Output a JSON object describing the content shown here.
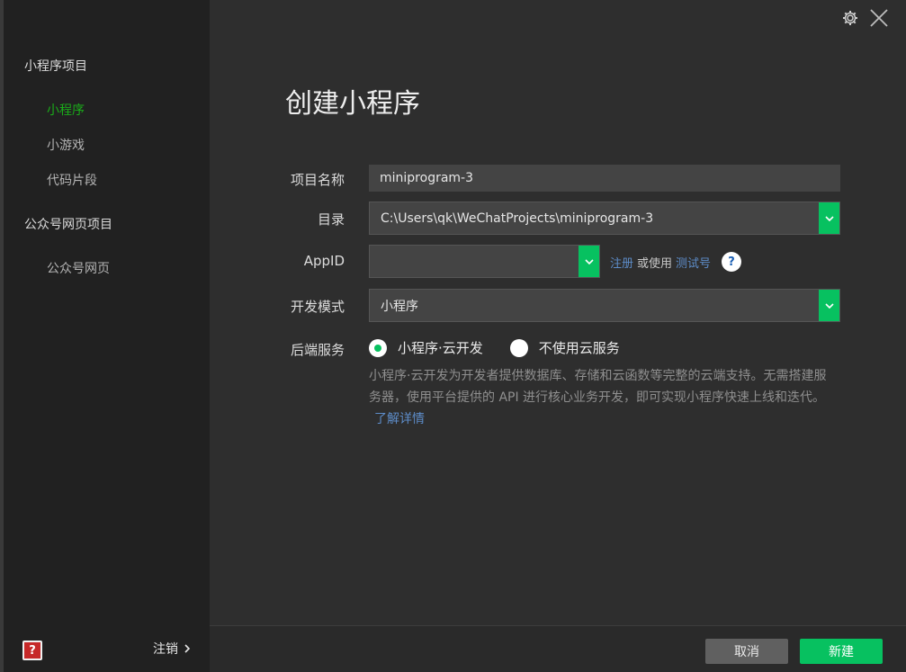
{
  "sidebar": {
    "groups": [
      {
        "label": "小程序项目",
        "items": [
          "小程序",
          "小游戏",
          "代码片段"
        ]
      },
      {
        "label": "公众号网页项目",
        "items": [
          "公众号网页"
        ]
      }
    ],
    "active_item": "小程序",
    "logout_label": "注销"
  },
  "main": {
    "title": "创建小程序",
    "form": {
      "project_name_label": "项目名称",
      "project_name_value": "miniprogram-3",
      "directory_label": "目录",
      "directory_value": "C:\\Users\\qk\\WeChatProjects\\miniprogram-3",
      "appid_label": "AppID",
      "appid_value": "",
      "appid_register_link": "注册",
      "appid_or_use": "或使用",
      "appid_test_link": "测试号",
      "dev_mode_label": "开发模式",
      "dev_mode_value": "小程序",
      "backend_label": "后端服务",
      "backend_options": [
        "小程序·云开发",
        "不使用云服务"
      ],
      "backend_selected": "小程序·云开发",
      "backend_desc": "小程序·云开发为开发者提供数据库、存储和云函数等完整的云端支持。无需搭建服务器，使用平台提供的 API 进行核心业务开发，即可实现小程序快速上线和迭代。",
      "learn_more": "了解详情"
    }
  },
  "footer": {
    "cancel_label": "取消",
    "new_label": "新建"
  },
  "colors": {
    "accent": "#07c160",
    "link": "#5d8cc8"
  }
}
